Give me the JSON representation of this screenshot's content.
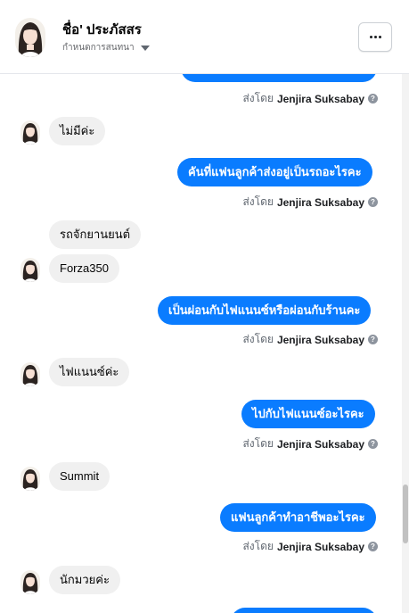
{
  "header": {
    "name": "ชื่อ' ประภัสสร",
    "subtitle": "กำหนดการสนทนา"
  },
  "conversation": {
    "messages": [
      {
        "from": "page",
        "text": "",
        "sent_by_label": "ส่งโดย",
        "sent_by": "Jenjira Suksabay"
      },
      {
        "from": "user",
        "text": "ไม่มีค่ะ"
      },
      {
        "from": "page",
        "text": "คันที่แฟนลูกค้าส่งอยู่เป็นรถอะไรคะ",
        "sent_by_label": "ส่งโดย",
        "sent_by": "Jenjira Suksabay"
      },
      {
        "from": "user",
        "text": "รถจักยานยนต์"
      },
      {
        "from": "user",
        "text": "Forza350"
      },
      {
        "from": "page",
        "text": "เป็นผ่อนกับไฟแนนซ์หรือผ่อนกับร้านคะ",
        "sent_by_label": "ส่งโดย",
        "sent_by": "Jenjira Suksabay"
      },
      {
        "from": "user",
        "text": "ไฟแนนซ์ค่ะ"
      },
      {
        "from": "page",
        "text": "ไปกับไฟแนนซ์อะไรคะ",
        "sent_by_label": "ส่งโดย",
        "sent_by": "Jenjira Suksabay"
      },
      {
        "from": "user",
        "text": "Summit"
      },
      {
        "from": "page",
        "text": "แฟนลูกค้าทำอาชีพอะไรคะ",
        "sent_by_label": "ส่งโดย",
        "sent_by": "Jenjira Suksabay"
      },
      {
        "from": "user",
        "text": "นักมวยค่ะ"
      },
      {
        "from": "page",
        "text": ""
      }
    ]
  },
  "icons": {
    "more": "more-horizontal-icon",
    "help": "help-circle-icon",
    "caret": "caret-down-icon",
    "avatar": "profile-photo"
  },
  "colors": {
    "outgoing_bubble": "#0a7cff",
    "incoming_bubble": "#f0f0f0",
    "meta_text": "#606770"
  }
}
